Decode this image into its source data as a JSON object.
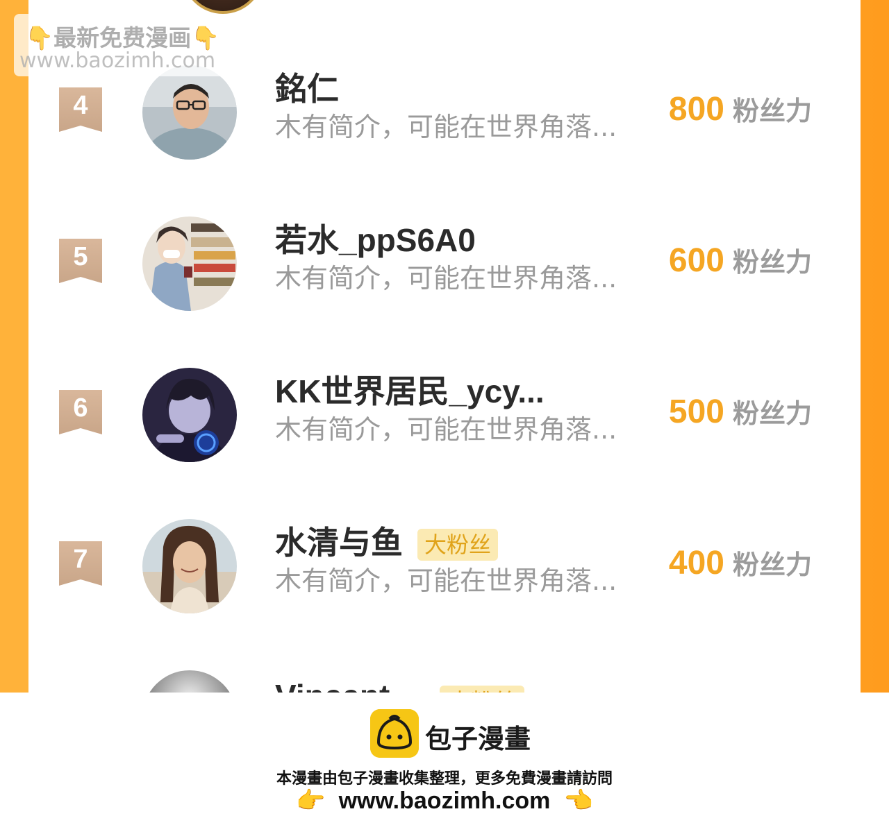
{
  "watermark": {
    "line1": "👇最新免费漫画👇",
    "line2": "www.baozimh.com"
  },
  "rankings": [
    {
      "rank": "4",
      "name": "銘仁",
      "badge": "",
      "bio": "木有简介，可能在世界角落...",
      "score": "800",
      "unit": "粉丝力",
      "avatar": "avatar-photo-man-glasses"
    },
    {
      "rank": "5",
      "name": "若水_ppS6A0",
      "badge": "",
      "bio": "木有简介，可能在世界角落...",
      "score": "600",
      "unit": "粉丝力",
      "avatar": "avatar-anime-store"
    },
    {
      "rank": "6",
      "name": "KK世界居民_ycy...",
      "badge": "",
      "bio": "木有简介，可能在世界角落...",
      "score": "500",
      "unit": "粉丝力",
      "avatar": "avatar-anime-dark-hair"
    },
    {
      "rank": "7",
      "name": "水清与鱼",
      "badge": "大粉丝",
      "bio": "木有简介，可能在世界角落...",
      "score": "400",
      "unit": "粉丝力",
      "avatar": "avatar-photo-woman"
    }
  ],
  "partial_row": {
    "name": "Vincent",
    "badge": "大粉丝"
  },
  "footer": {
    "brand": "包子漫畫",
    "notice": "本漫畫由包子漫畫收集整理，更多免費漫畫請訪問",
    "url": "www.baozimh.com",
    "left_hand": "👉",
    "right_hand": "👈"
  },
  "colors": {
    "frame": "#ffad32",
    "score": "#f5a623",
    "badge_bg": "#fbeab3",
    "rank_ribbon": "#d2b091"
  }
}
